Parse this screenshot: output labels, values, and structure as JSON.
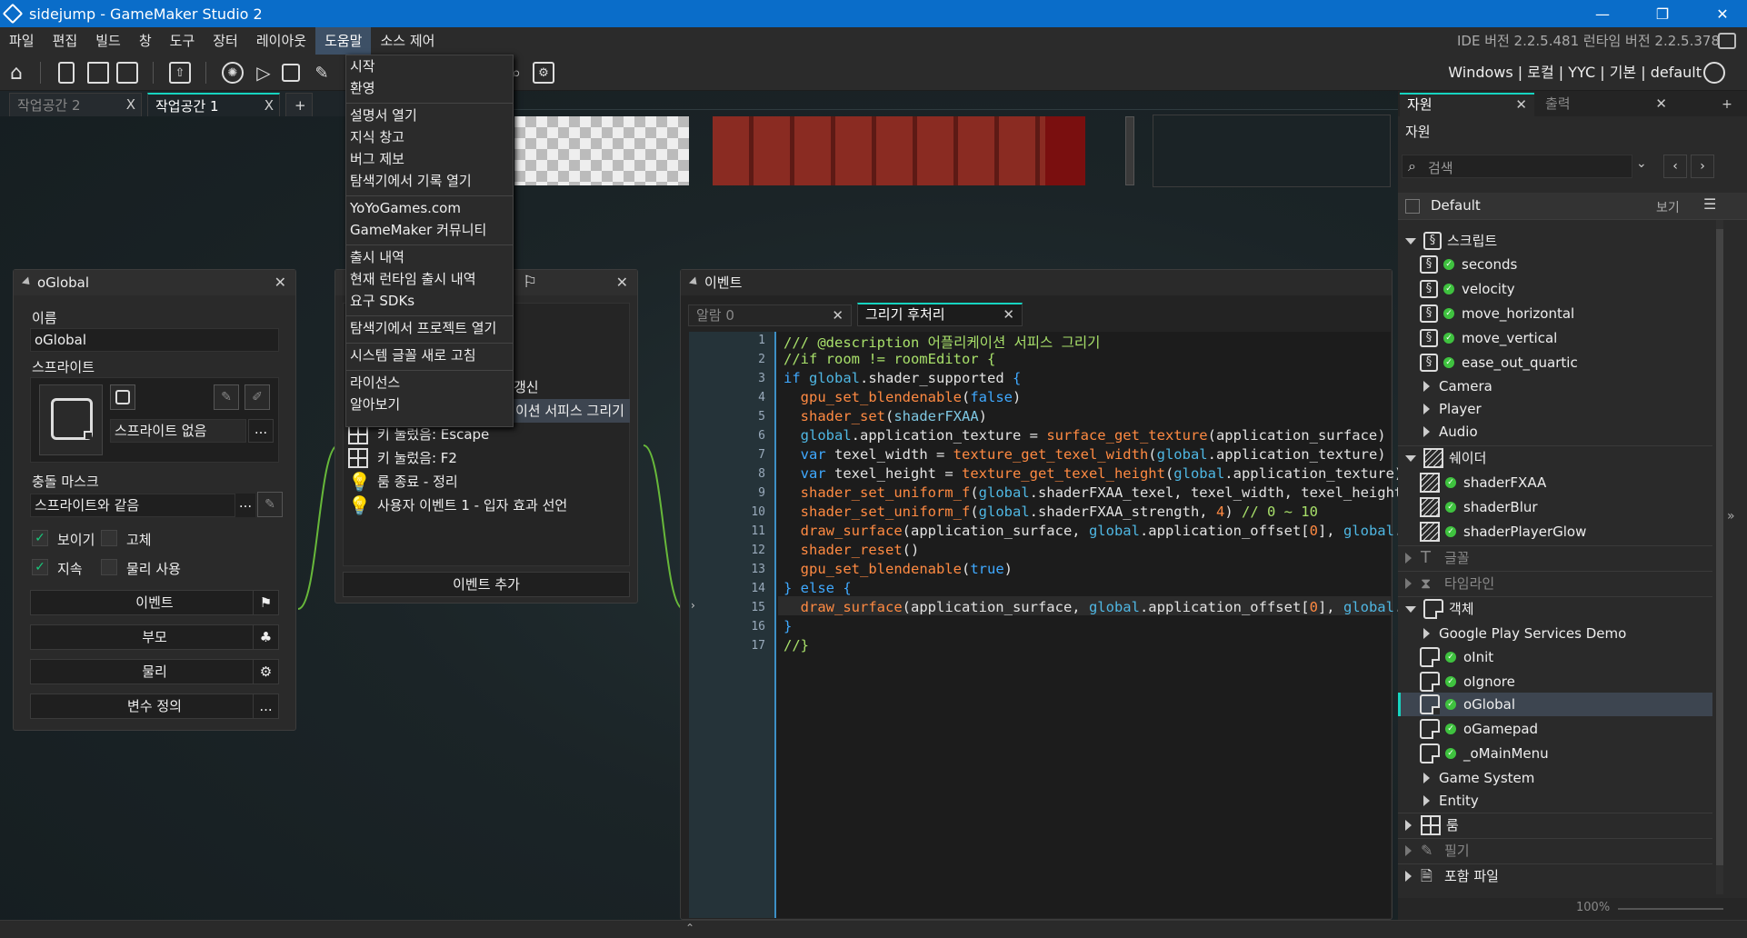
{
  "window": {
    "title": "sidejump - GameMaker Studio 2",
    "minimize": "—",
    "restore": "❐",
    "close": "✕"
  },
  "menu": {
    "items": [
      "파일",
      "편집",
      "빌드",
      "창",
      "도구",
      "장터",
      "레이아웃",
      "도움말",
      "소스 제어"
    ],
    "version": "IDE 버전 2.2.5.481 런타임 버전 2.2.5.378"
  },
  "toolbar": {
    "target": "Windows | 로컬 | YYC | 기본 | default"
  },
  "workspaces": {
    "tab1": "작업공간 2",
    "tab2": "작업공간 1",
    "add": "+",
    "close": "X"
  },
  "help_menu": {
    "items": [
      "시작",
      "환영",
      "설명서 열기",
      "지식 창고",
      "버그 제보",
      "탐색기에서 기록 열기",
      "YoYoGames.com",
      "GameMaker 커뮤니티",
      "출시 내역",
      "현재 런타임 출시 내역",
      "요구 SDKs",
      "탐색기에서 프로젝트 열기",
      "시스템 글꼴 새로 고침",
      "라이선스",
      "알아보기"
    ]
  },
  "object_panel": {
    "title": "oGlobal",
    "name_label": "이름",
    "name_value": "oGlobal",
    "sprite_label": "스프라이트",
    "sprite_value": "스프라이트 없음",
    "mask_label": "충돌 마스크",
    "mask_value": "스프라이트와 같음",
    "visible": "보이기",
    "solid": "고체",
    "persistent": "지속",
    "physics": "물리 사용",
    "events_btn": "이벤트",
    "parent_btn": "부모",
    "physics_btn": "물리",
    "vardef_btn": "변수 정의",
    "more": "..."
  },
  "events_panel": {
    "partial_1": "갱신",
    "partial_2": "이션 서피스 그리기",
    "rows": [
      "키 눌렀음: Escape",
      "키 눌렀음: F2",
      "룸 종료 - 정리",
      "사용자 이벤트 1 - 입자 효과 선언"
    ],
    "add_btn": "이벤트 추가"
  },
  "code_editor": {
    "title": "이벤트",
    "tab_inactive": "알람 0",
    "tab_active": "그리기 후처리",
    "line_numbers": [
      "1",
      "2",
      "3",
      "4",
      "5",
      "6",
      "7",
      "8",
      "9",
      "10",
      "11",
      "12",
      "13",
      "14",
      "15",
      "16",
      "17"
    ]
  },
  "resources": {
    "tab_active": "자원",
    "tab_output": "출력",
    "header": "자원",
    "search_placeholder": "검색",
    "group": "Default",
    "view": "보기",
    "zoom": "100%",
    "tree": [
      {
        "label": "스크립트"
      },
      {
        "label": "seconds"
      },
      {
        "label": "velocity"
      },
      {
        "label": "move_horizontal"
      },
      {
        "label": "move_vertical"
      },
      {
        "label": "ease_out_quartic"
      },
      {
        "label": "Camera"
      },
      {
        "label": "Player"
      },
      {
        "label": "Audio"
      },
      {
        "label": "쉐이더"
      },
      {
        "label": "shaderFXAA"
      },
      {
        "label": "shaderBlur"
      },
      {
        "label": "shaderPlayerGlow"
      },
      {
        "label": "글꼴"
      },
      {
        "label": "타임라인"
      },
      {
        "label": "객체"
      },
      {
        "label": "Google Play Services Demo"
      },
      {
        "label": "oInit"
      },
      {
        "label": "oIgnore"
      },
      {
        "label": "oGlobal"
      },
      {
        "label": "oGamepad"
      },
      {
        "label": "_oMainMenu"
      },
      {
        "label": "Game System"
      },
      {
        "label": "Entity"
      },
      {
        "label": "룸"
      },
      {
        "label": "필기"
      },
      {
        "label": "포함 파일"
      }
    ]
  },
  "colors": {
    "titlebar": "#0a6dc9",
    "accent": "#16d4c0",
    "selection": "#3d4550"
  }
}
